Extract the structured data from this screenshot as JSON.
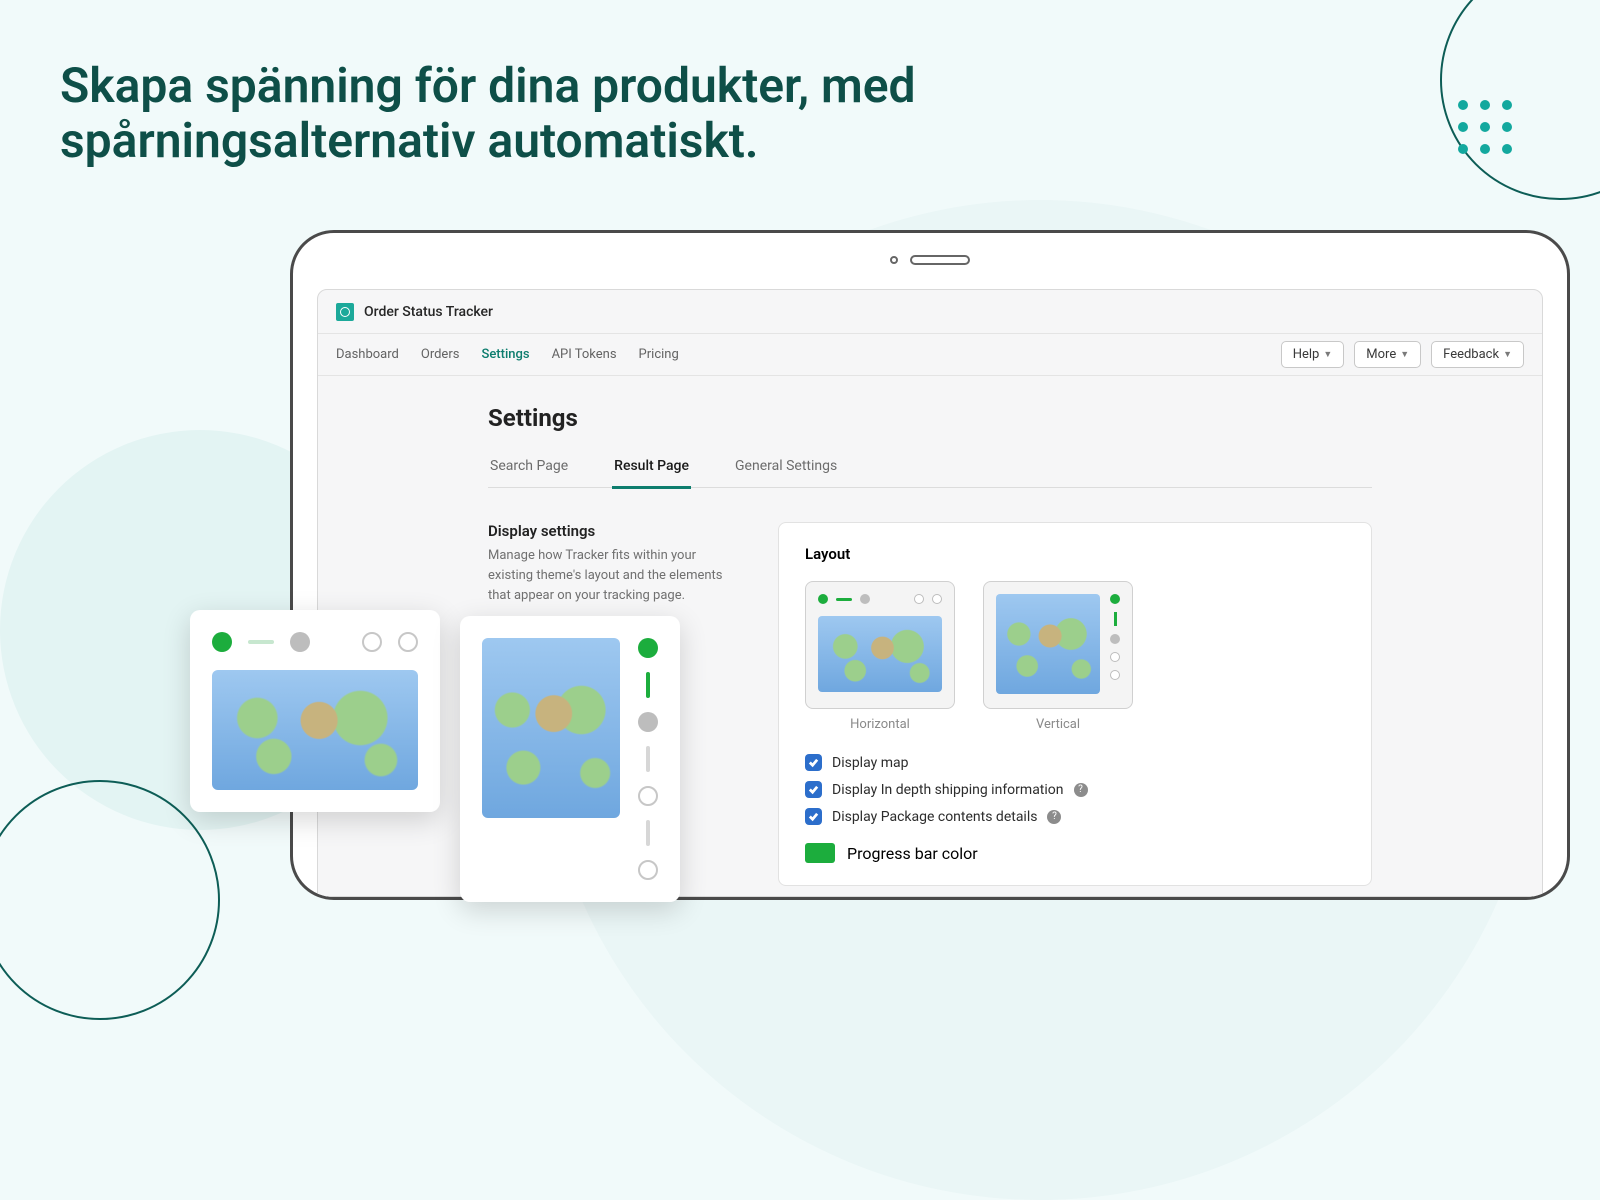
{
  "headline": "Skapa spänning för dina produkter, med spårningsalternativ automatiskt.",
  "app": {
    "title": "Order Status Tracker",
    "nav": {
      "dashboard": "Dashboard",
      "orders": "Orders",
      "settings": "Settings",
      "api_tokens": "API Tokens",
      "pricing": "Pricing"
    },
    "nav_right": {
      "help": "Help",
      "more": "More",
      "feedback": "Feedback"
    }
  },
  "page": {
    "title": "Settings",
    "tabs": {
      "search_page": "Search Page",
      "result_page": "Result Page",
      "general_settings": "General Settings"
    },
    "display_settings": {
      "title": "Display settings",
      "desc": "Manage how Tracker fits within your existing theme's layout and the elements that appear on your tracking page."
    },
    "layout": {
      "title": "Layout",
      "horizontal": "Horizontal",
      "vertical": "Vertical"
    },
    "checks": {
      "display_map": "Display map",
      "display_shipping": "Display In depth shipping information",
      "display_package": "Display Package contents details"
    },
    "color_label": "Progress bar color",
    "progress_color": "#1cad3d"
  }
}
